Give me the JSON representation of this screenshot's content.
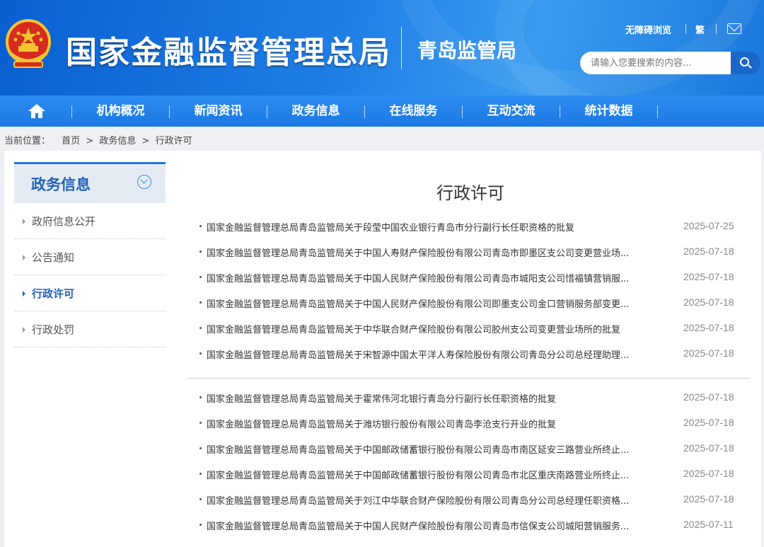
{
  "header": {
    "site_title": "国家金融监督管理总局",
    "sub_title": "青岛监管局",
    "accessibility_label": "无障碍浏览",
    "traditional_label": "繁",
    "search_placeholder": "请输入您要搜索的内容..."
  },
  "nav": {
    "items": [
      "机构概况",
      "新闻资讯",
      "政务信息",
      "在线服务",
      "互动交流",
      "统计数据"
    ]
  },
  "breadcrumb": {
    "prefix": "当前位置：",
    "items": [
      "首页",
      "政务信息",
      "行政许可"
    ],
    "separator": ">"
  },
  "sidebar": {
    "title": "政务信息",
    "items": [
      "政府信息公开",
      "公告通知",
      "行政许可",
      "行政处罚"
    ],
    "active_index": 2
  },
  "main": {
    "title": "行政许可",
    "group1": [
      {
        "title": "国家金融监督管理总局青岛监管局关于段莹中国农业银行青岛市分行副行长任职资格的批复",
        "date": "2025-07-25"
      },
      {
        "title": "国家金融监督管理总局青岛监管局关于中国人寿财产保险股份有限公司青岛市即墨区支公司变更营业场...",
        "date": "2025-07-18"
      },
      {
        "title": "国家金融监督管理总局青岛监管局关于中国人民财产保险股份有限公司青岛市城阳支公司惜福镇营销服...",
        "date": "2025-07-18"
      },
      {
        "title": "国家金融监督管理总局青岛监管局关于中国人民财产保险股份有限公司即墨支公司金口营销服务部变更...",
        "date": "2025-07-18"
      },
      {
        "title": "国家金融监督管理总局青岛监管局关于中华联合财产保险股份有限公司胶州支公司变更营业场所的批复",
        "date": "2025-07-18"
      },
      {
        "title": "国家金融监督管理总局青岛监管局关于宋智源中国太平洋人寿保险股份有限公司青岛分公司总经理助理...",
        "date": "2025-07-18"
      }
    ],
    "group2": [
      {
        "title": "国家金融监督管理总局青岛监管局关于霍常伟河北银行青岛分行副行长任职资格的批复",
        "date": "2025-07-18"
      },
      {
        "title": "国家金融监督管理总局青岛监管局关于潍坊银行股份有限公司青岛李沧支行开业的批复",
        "date": "2025-07-18"
      },
      {
        "title": "国家金融监督管理总局青岛监管局关于中国邮政储蓄银行股份有限公司青岛市南区延安三路营业所终止...",
        "date": "2025-07-18"
      },
      {
        "title": "国家金融监督管理总局青岛监管局关于中国邮政储蓄银行股份有限公司青岛市北区重庆南路营业所终止...",
        "date": "2025-07-18"
      },
      {
        "title": "国家金融监督管理总局青岛监管局关于刘江中华联合财产保险股份有限公司青岛分公司总经理任职资格...",
        "date": "2025-07-18"
      },
      {
        "title": "国家金融监督管理总局青岛监管局关于中国人民财产保险股份有限公司青岛市信保支公司城阳营销服务...",
        "date": "2025-07-11"
      }
    ]
  },
  "colors": {
    "header_blue": "#1f7fe6",
    "nav_blue": "#2d8cf0",
    "accent": "#1f62b8"
  }
}
